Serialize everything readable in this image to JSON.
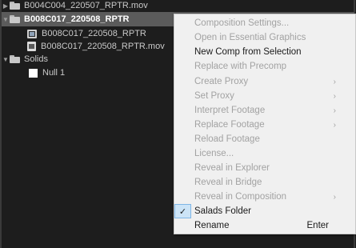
{
  "project": {
    "items": [
      {
        "label": "B004C004_220507_RPTR.mov"
      },
      {
        "label": "B008C017_220508_RPTR"
      },
      {
        "label": "B008C017_220508_RPTR"
      },
      {
        "label": "B008C017_220508_RPTR.mov"
      },
      {
        "label": "Solids"
      },
      {
        "label": "Null 1"
      }
    ]
  },
  "context_menu": {
    "items": [
      {
        "label": "Composition Settings...",
        "enabled": false
      },
      {
        "label": "Open in Essential Graphics",
        "enabled": false
      },
      {
        "label": "New Comp from Selection",
        "enabled": true
      },
      {
        "label": "Replace with Precomp",
        "enabled": false
      },
      {
        "label": "Create Proxy",
        "enabled": false,
        "submenu": true
      },
      {
        "label": "Set Proxy",
        "enabled": false,
        "submenu": true
      },
      {
        "label": "Interpret Footage",
        "enabled": false,
        "submenu": true
      },
      {
        "label": "Replace Footage",
        "enabled": false,
        "submenu": true
      },
      {
        "label": "Reload Footage",
        "enabled": false
      },
      {
        "label": "License...",
        "enabled": false
      },
      {
        "label": "Reveal in Explorer",
        "enabled": false
      },
      {
        "label": "Reveal in Bridge",
        "enabled": false
      },
      {
        "label": "Reveal in Composition",
        "enabled": false,
        "submenu": true
      },
      {
        "label": "Salads Folder",
        "enabled": true,
        "checked": true
      },
      {
        "label": "Rename",
        "enabled": true,
        "shortcut": "Enter"
      }
    ],
    "check_glyph": "✓",
    "submenu_glyph": "›"
  },
  "colors": {
    "panel_bg": "#1d1d1d",
    "selected_row": "#5b5b5b",
    "menu_bg": "#f0f0f0",
    "check_highlight": "#cce4f7"
  }
}
